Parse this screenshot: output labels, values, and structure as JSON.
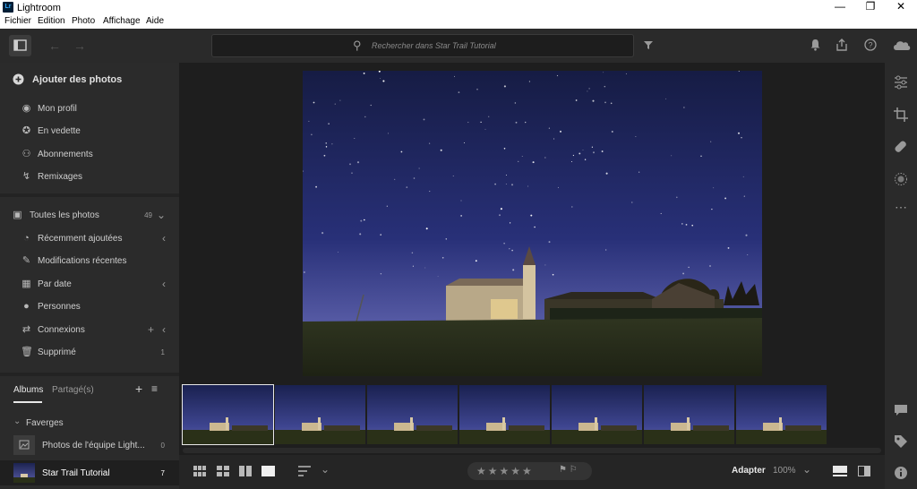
{
  "window": {
    "title": "Lightroom",
    "logo": "Lr",
    "controls": {
      "minimize": "—",
      "restore": "❐",
      "close": "✕"
    }
  },
  "menu": [
    "Fichier",
    "Edition",
    "Photo",
    "Affichage",
    "Aide"
  ],
  "topbar": {
    "search_placeholder": "Rechercher dans Star Trail Tutorial"
  },
  "sidebar": {
    "add_photos": "Ajouter des photos",
    "community": [
      {
        "label": "Mon profil",
        "icon": "profile-icon"
      },
      {
        "label": "En vedette",
        "icon": "featured-icon"
      },
      {
        "label": "Abonnements",
        "icon": "subscriptions-icon"
      },
      {
        "label": "Remixages",
        "icon": "remix-icon"
      }
    ],
    "library": {
      "all_photos": {
        "label": "Toutes les photos",
        "count": "49"
      },
      "items": [
        {
          "label": "Récemment ajoutées",
          "icon": "clock-icon"
        },
        {
          "label": "Modifications récentes",
          "icon": "edit-icon"
        },
        {
          "label": "Par date",
          "icon": "calendar-icon"
        },
        {
          "label": "Personnes",
          "icon": "person-icon"
        },
        {
          "label": "Connexions",
          "icon": "connections-icon"
        },
        {
          "label": "Supprimé",
          "icon": "trash-icon",
          "count": "1"
        }
      ]
    },
    "albums": {
      "tab_albums": "Albums",
      "tab_shared": "Partagé(s)",
      "group": "Faverges",
      "items": [
        {
          "label": "Photos de l'équipe Light...",
          "count": "0"
        },
        {
          "label": "Star Trail Tutorial",
          "count": "7"
        }
      ]
    }
  },
  "bottombar": {
    "fit_label": "Adapter",
    "zoom": "100%"
  },
  "filmstrip": {
    "count": 7,
    "selected_index": 0
  },
  "colors": {
    "accent": "#31a8ff",
    "sky_top": "#1c2350",
    "sky_bottom": "#5a5ea8",
    "ground": "#2a3018"
  }
}
